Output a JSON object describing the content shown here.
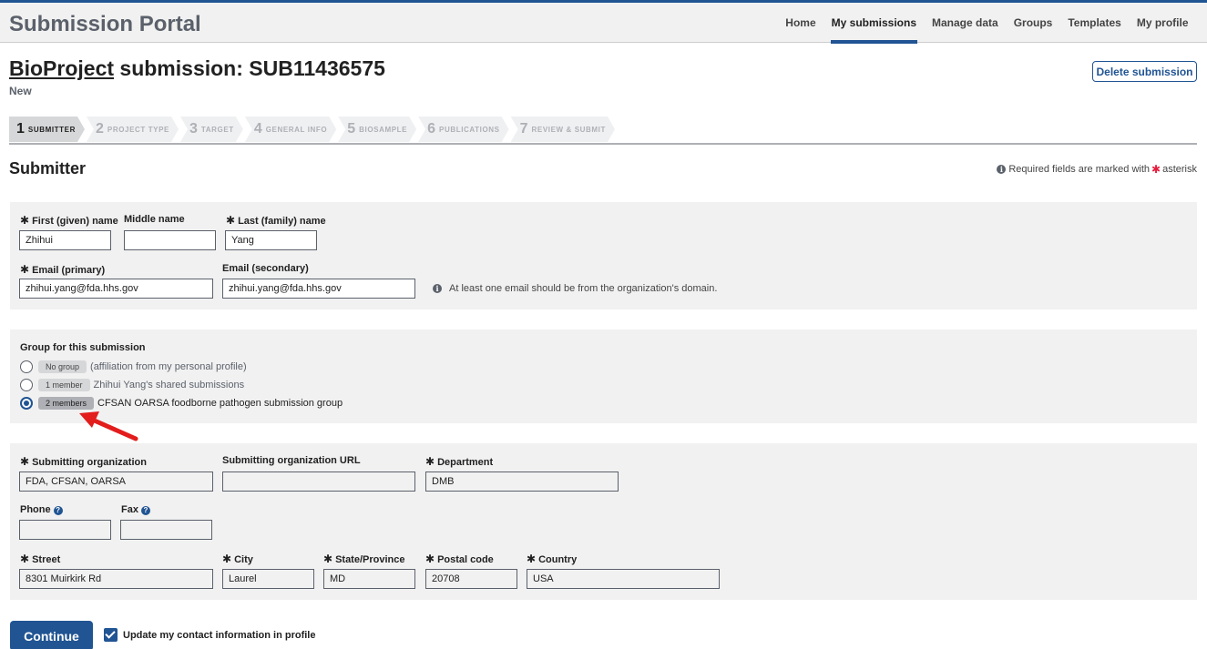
{
  "header": {
    "title": "Submission Portal",
    "nav": [
      "Home",
      "My submissions",
      "Manage data",
      "Groups",
      "Templates",
      "My profile"
    ],
    "active_nav": "My submissions"
  },
  "page": {
    "heading_link": "BioProject",
    "heading_rest": " submission: SUB11436575",
    "status": "New",
    "delete_label": "Delete submission"
  },
  "steps": [
    {
      "num": "1",
      "label": "Submitter"
    },
    {
      "num": "2",
      "label": "Project type"
    },
    {
      "num": "3",
      "label": "Target"
    },
    {
      "num": "4",
      "label": "General info"
    },
    {
      "num": "5",
      "label": "BioSample"
    },
    {
      "num": "6",
      "label": "Publications"
    },
    {
      "num": "7",
      "label": "Review & submit"
    }
  ],
  "section": {
    "title": "Submitter",
    "required_note_pre": "Required fields are marked with",
    "required_note_post": "asterisk"
  },
  "submitter": {
    "first_name_label": "First (given) name",
    "first_name": "Zhihui",
    "middle_name_label": "Middle name",
    "middle_name": "",
    "last_name_label": "Last (family) name",
    "last_name": "Yang",
    "email_primary_label": "Email (primary)",
    "email_primary": "zhihui.yang@fda.hhs.gov",
    "email_secondary_label": "Email (secondary)",
    "email_secondary": "zhihui.yang@fda.hhs.gov",
    "email_note": "At least one email should be from the organization's domain."
  },
  "group": {
    "label": "Group for this submission",
    "options": [
      {
        "badge": "No group",
        "text": "(affiliation from my personal profile)",
        "selected": false
      },
      {
        "badge": "1 member",
        "text": "Zhihui Yang's shared submissions",
        "selected": false
      },
      {
        "badge": "2 members",
        "text": "CFSAN OARSA foodborne pathogen submission group",
        "selected": true
      }
    ]
  },
  "org": {
    "org_label": "Submitting organization",
    "org": "FDA, CFSAN, OARSA",
    "url_label": "Submitting organization URL",
    "url": "",
    "dept_label": "Department",
    "dept": "DMB",
    "phone_label": "Phone",
    "phone": "",
    "fax_label": "Fax",
    "fax": "",
    "street_label": "Street",
    "street": "8301 Muirkirk Rd",
    "city_label": "City",
    "city": "Laurel",
    "state_label": "State/Province",
    "state": "MD",
    "postal_label": "Postal code",
    "postal": "20708",
    "country_label": "Country",
    "country": "USA"
  },
  "footer": {
    "continue_label": "Continue",
    "update_label": "Update my contact information in profile",
    "update_checked": true
  },
  "colors": {
    "primary": "#205493",
    "required_star": "#e31c3d",
    "arrow": "#e31c1c"
  }
}
